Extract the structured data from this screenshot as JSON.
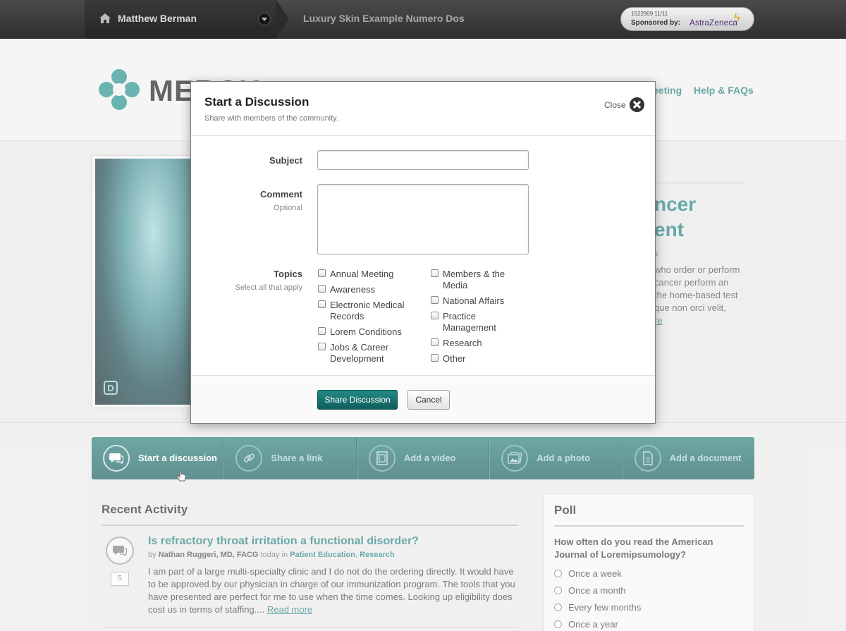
{
  "topbar": {
    "user_name": "Matthew Berman",
    "site_name": "Luxury Skin Example Numero Dos",
    "sponsor_code": "1522909  11/11",
    "sponsor_by": "Sponsored by:",
    "sponsor_brand": "AstraZeneca"
  },
  "header": {
    "logo_text": "MERCK",
    "nav": [
      "eeting",
      "Help & FAQs"
    ]
  },
  "hero": {
    "title_lines": [
      "ncer",
      "ent"
    ],
    "meta": "s",
    "text_lines": [
      "who order or perform",
      "cancer perform an",
      "the home-based test",
      "que non orci velit,"
    ],
    "more": "re"
  },
  "modal": {
    "title": "Start a Discussion",
    "subtitle": "Share with members of the community.",
    "close_label": "Close",
    "subject_label": "Subject",
    "comment_label": "Comment",
    "comment_hint": "Optional",
    "topics_label": "Topics",
    "topics_hint": "Select all that apply",
    "topics_left": [
      "Annual Meeting",
      "Awareness",
      "Electronic Medical Records",
      "Lorem Conditions",
      "Jobs & Career Development"
    ],
    "topics_right": [
      "Members & the Media",
      "National Affairs",
      "Practice Management",
      "Research",
      "Other"
    ],
    "share_button": "Share Discussion",
    "cancel_button": "Cancel"
  },
  "actions": [
    {
      "label": "Start a discussion",
      "icon": "discussion-icon"
    },
    {
      "label": "Share a link",
      "icon": "link-icon"
    },
    {
      "label": "Add a video",
      "icon": "video-icon"
    },
    {
      "label": "Add a photo",
      "icon": "photo-icon"
    },
    {
      "label": "Add a document",
      "icon": "document-icon"
    }
  ],
  "recent": {
    "title": "Recent Activity",
    "item": {
      "title": "Is refractory throat irritation a functional disorder?",
      "by": "by",
      "author": "Nathan Ruggeri, MD, FACG",
      "when": "today in",
      "cat1": "Patient Education",
      "cat2": "Research",
      "count": "5",
      "body": "I am part of a large multi-specialty clinic and I do not do the ordering directly. It would have to be approved by our physician in charge of our immunization program. The tools that you have presented are perfect for me to use when the time comes. Looking up eligibility does cost us in terms of staffing.... ",
      "read_more": "Read more"
    }
  },
  "poll": {
    "title": "Poll",
    "question": "How often do you read the American Journal of Loremipsumology?",
    "options": [
      "Once a week",
      "Once a month",
      "Every few months",
      "Once a year"
    ]
  },
  "colors": {
    "accent": "#1a7b79",
    "topbar": "#3a3a3a"
  }
}
